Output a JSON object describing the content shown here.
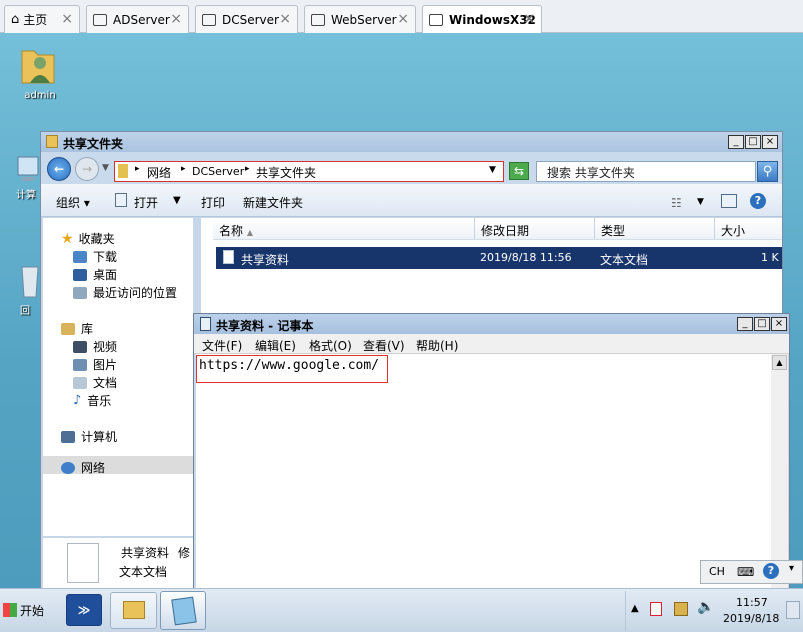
{
  "host_tabs": [
    {
      "label": "主页",
      "active": false
    },
    {
      "label": "ADServer",
      "active": false
    },
    {
      "label": "DCServer",
      "active": false
    },
    {
      "label": "WebServer",
      "active": false
    },
    {
      "label": "WindowsX32",
      "active": true
    }
  ],
  "desktop": {
    "icons": [
      {
        "label": "admin",
        "icon": "user-folder-icon"
      },
      {
        "label": "计算",
        "icon": "computer-icon"
      },
      {
        "label": "回",
        "icon": "recycle-bin-icon"
      }
    ]
  },
  "explorer": {
    "title": "共享文件夹",
    "breadcrumb": [
      "网络",
      "DCServer",
      "共享文件夹"
    ],
    "search_placeholder": "搜索 共享文件夹",
    "commands": {
      "organize": "组织",
      "open": "打开",
      "print": "打印",
      "new_folder": "新建文件夹"
    },
    "nav": {
      "favorites": "收藏夹",
      "favorites_items": [
        "下载",
        "桌面",
        "最近访问的位置"
      ],
      "libraries": "库",
      "libraries_items": [
        "视频",
        "图片",
        "文档",
        "音乐"
      ],
      "computer": "计算机",
      "network": "网络"
    },
    "columns": [
      "名称",
      "修改日期",
      "类型",
      "大小"
    ],
    "files": [
      {
        "name": "共享资料",
        "modified": "2019/8/18 11:56",
        "type": "文本文档",
        "size": "1 K"
      }
    ],
    "details": {
      "name": "共享资料",
      "extra": "修",
      "type": "文本文档"
    }
  },
  "notepad": {
    "title": "共享资料 - 记事本",
    "menu": [
      "文件(F)",
      "编辑(E)",
      "格式(O)",
      "查看(V)",
      "帮助(H)"
    ],
    "content": "https://www.google.com/"
  },
  "taskbar": {
    "start_label": "开始",
    "time": "11:57",
    "date": "2019/8/18",
    "lang": "CH"
  },
  "colors": {
    "desktop": "#5aa7c4",
    "selection": "#18356b",
    "highlight_box": "#e0312f"
  }
}
